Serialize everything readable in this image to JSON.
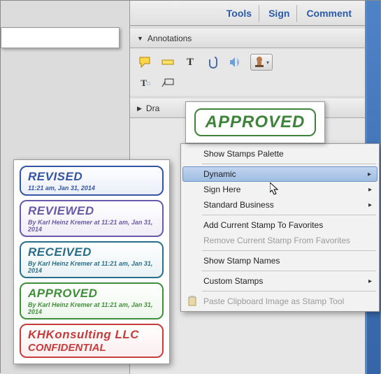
{
  "tabs": {
    "tools": "Tools",
    "sign": "Sign",
    "comment": "Comment"
  },
  "sections": {
    "annotations": "Annotations",
    "drawing": "Dra"
  },
  "preview": {
    "approved": "APPROVED"
  },
  "menu": {
    "show_palette": "Show Stamps Palette",
    "dynamic": "Dynamic",
    "sign_here": "Sign Here",
    "standard_business": "Standard Business",
    "add_fav": "Add Current Stamp To Favorites",
    "remove_fav": "Remove Current Stamp From Favorites",
    "show_names": "Show Stamp Names",
    "custom": "Custom Stamps",
    "paste": "Paste Clipboard Image as Stamp Tool"
  },
  "stamps": {
    "revised": {
      "title": "REVISED",
      "meta": "11:21 am, Jan 31, 2014"
    },
    "reviewed": {
      "title": "REVIEWED",
      "meta": "By Karl Heinz Kremer at 11:21 am, Jan 31, 2014"
    },
    "received": {
      "title": "RECEIVED",
      "meta": "By Karl Heinz Kremer at 11:21 am, Jan 31, 2014"
    },
    "approved": {
      "title": "APPROVED",
      "meta": "By Karl Heinz Kremer at 11:21 am, Jan 31, 2014"
    },
    "conf": {
      "title": "KHKonsulting LLC",
      "meta": "CONFIDENTIAL"
    }
  }
}
